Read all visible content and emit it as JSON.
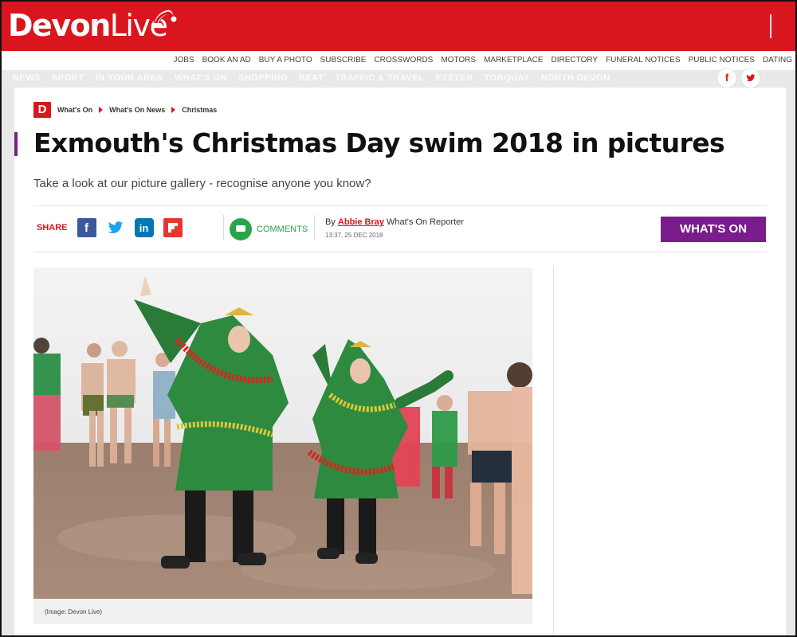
{
  "header": {
    "logo_main": "Devon",
    "logo_live": "Live"
  },
  "utility_nav": [
    "JOBS",
    "BOOK AN AD",
    "BUY A PHOTO",
    "SUBSCRIBE",
    "CROSSWORDS",
    "MOTORS",
    "MARKETPLACE",
    "DIRECTORY",
    "FUNERAL NOTICES",
    "PUBLIC NOTICES",
    "DATING"
  ],
  "main_nav": [
    "NEWS",
    "SPORT",
    "IN YOUR AREA",
    "WHAT'S ON",
    "SHOPPING",
    "BEAT",
    "TRAFFIC & TRAVEL",
    "EXETER",
    "TORQUAY",
    "NORTH DEVON"
  ],
  "social_top": {
    "facebook": "f",
    "twitter": "t"
  },
  "breadcrumb": {
    "logo": "D",
    "items": [
      "What's On",
      "What's On News",
      "Christmas"
    ]
  },
  "article": {
    "title": "Exmouth's Christmas Day swim 2018 in pictures",
    "standfirst": "Take a look at our picture gallery - recognise anyone you know?",
    "share_label": "SHARE",
    "comments_label": "COMMENTS",
    "byline_prefix": "By",
    "author": "Abbie Bray",
    "author_role": "What's On Reporter",
    "date": "13:37, 25 DEC 2018",
    "section_button": "WHAT'S ON",
    "image_caption": "(Image: Devon Live)"
  },
  "share_icons": {
    "facebook": "f",
    "twitter": "🐦",
    "linkedin": "in",
    "flipboard": "f"
  },
  "colors": {
    "brand_red": "#d9161d",
    "section_purple": "#7a1c8c",
    "comments_green": "#2aa44a"
  }
}
